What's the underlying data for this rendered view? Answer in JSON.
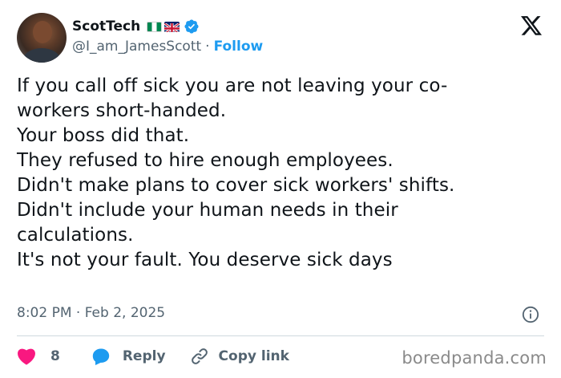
{
  "author": {
    "display_name": "ScotTech",
    "handle": "@I_am_JamesScott",
    "separator": "·",
    "follow_label": "Follow",
    "flags": [
      "nigeria-flag-icon",
      "uk-flag-icon"
    ],
    "verified_icon": "verified-badge-icon"
  },
  "brand": {
    "logo_icon": "x-logo-icon"
  },
  "tweet": {
    "text": "If you call off sick you are not leaving your co-\nworkers short-handed.\nYour boss did that.\nThey refused to hire enough employees.\nDidn't make plans to cover sick workers' shifts.\nDidn't include your human needs in their\ncalculations.\nIt's not your fault. You deserve sick days",
    "timestamp": "8:02 PM · Feb 2, 2025"
  },
  "actions": {
    "like_count": "8",
    "reply_label": "Reply",
    "copy_link_label": "Copy link"
  },
  "watermark": "boredpanda.com",
  "colors": {
    "accent": "#1d9bf0",
    "like_red": "#f91880",
    "text_primary": "#0f1419",
    "text_secondary": "#536471",
    "divider": "#cfd9de"
  }
}
